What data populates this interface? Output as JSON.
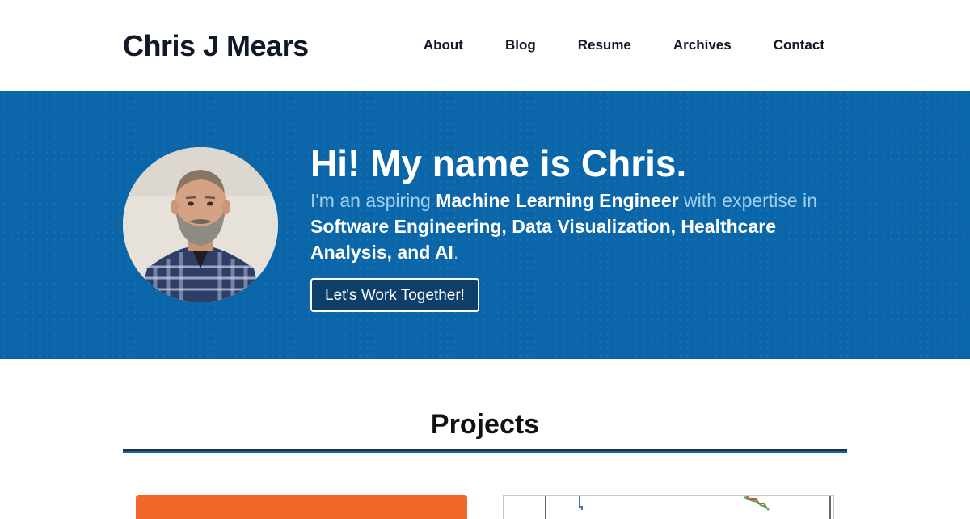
{
  "header": {
    "site_title": "Chris J Mears",
    "nav": [
      "About",
      "Blog",
      "Resume",
      "Archives",
      "Contact"
    ]
  },
  "hero": {
    "title": "Hi! My name is Chris.",
    "subtitle": {
      "p1": "I'm an aspiring ",
      "b1": "Machine Learning Engineer",
      "p2": " with expertise in ",
      "b2": "Software Engineering, Data Visualization, Healthcare Analysis, and AI",
      "p3": "."
    },
    "cta_label": "Let's Work Together!"
  },
  "projects": {
    "heading": "Projects"
  },
  "colors": {
    "hero_bg": "#0a66a8",
    "accent_text": "#9fd0f2",
    "cta_bg": "#0d3f6a",
    "project_card_orange": "#f2682a"
  }
}
